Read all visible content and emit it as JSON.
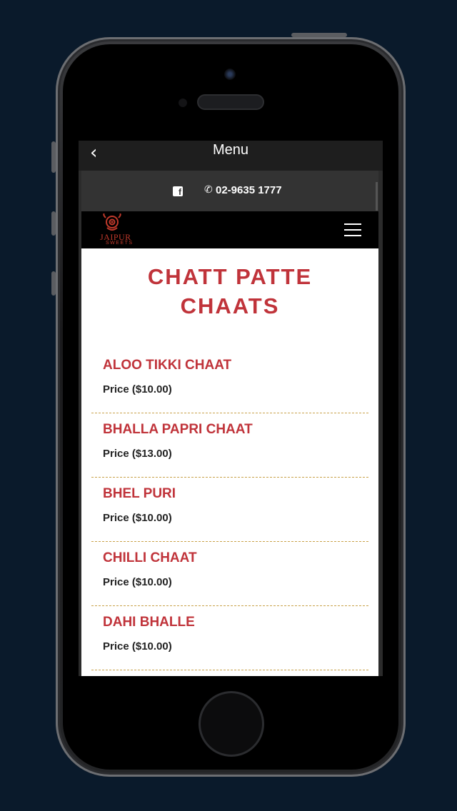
{
  "appbar": {
    "title": "Menu",
    "back_icon": "chevron-left-icon"
  },
  "contact": {
    "facebook_icon": "facebook-icon",
    "phone_icon": "phone-icon",
    "phone_number": "02-9635 1777"
  },
  "brand": {
    "logo_text": "JAIPUR",
    "logo_sub": "SWEETS",
    "accent": "#c0333a"
  },
  "nav": {
    "menu_icon": "hamburger-icon"
  },
  "page": {
    "title_line1": "CHATT PATTE",
    "title_line2": "CHAATS"
  },
  "items": [
    {
      "name": "ALOO TIKKI CHAAT",
      "price": "Price ($10.00)"
    },
    {
      "name": "BHALLA PAPRI CHAAT",
      "price": "Price ($13.00)"
    },
    {
      "name": "BHEL PURI",
      "price": "Price ($10.00)"
    },
    {
      "name": "CHILLI CHAAT",
      "price": "Price ($10.00)"
    },
    {
      "name": "DAHI BHALLE",
      "price": "Price ($10.00)"
    }
  ]
}
